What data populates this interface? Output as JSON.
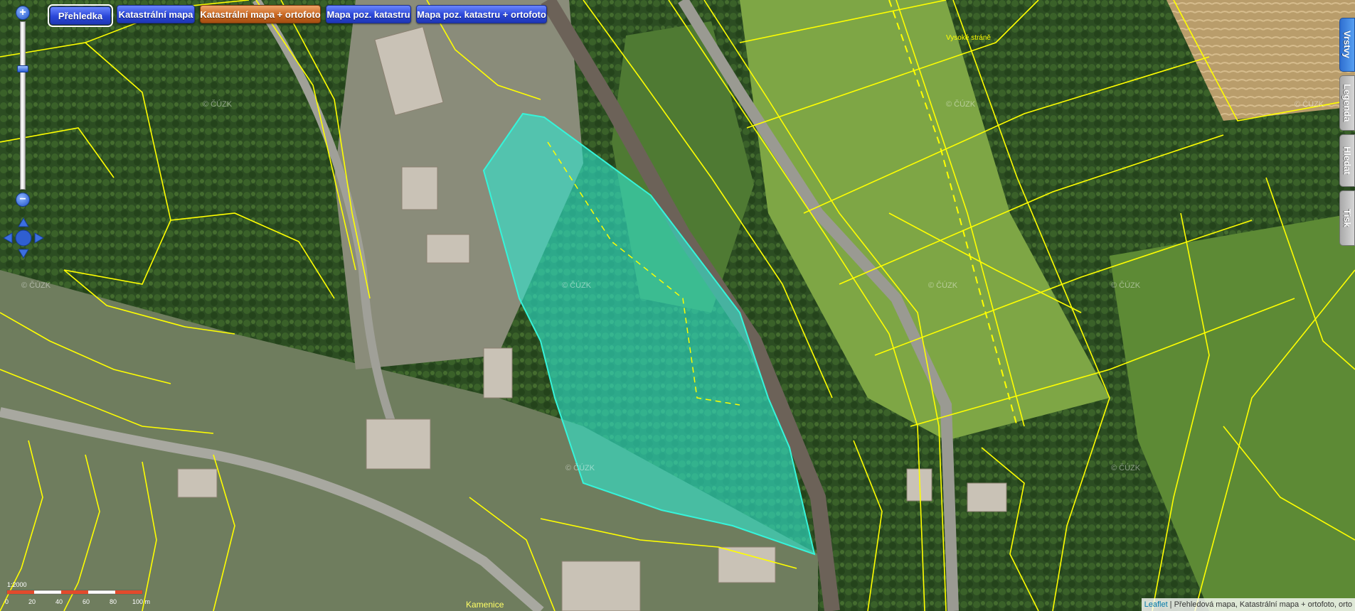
{
  "toolbar": {
    "buttons": [
      {
        "label": "Přehledka",
        "style": "blue",
        "active": true
      },
      {
        "label": "Katastrální mapa",
        "style": "blue",
        "active": false
      },
      {
        "label": "Katastrální mapa + ortofoto",
        "style": "orange",
        "active": false
      },
      {
        "label": "Mapa poz. katastru",
        "style": "blue",
        "active": false
      },
      {
        "label": "Mapa poz. katastru + ortofoto",
        "style": "blue",
        "active": false
      }
    ]
  },
  "side_tabs": [
    "Vrstvy",
    "Legenda",
    "Hledat",
    "Tisk"
  ],
  "zoom": {
    "in_symbol": "+",
    "out_symbol": "−",
    "level_fraction": 0.72
  },
  "map": {
    "watermark": "© ČÚZK",
    "place_label": "Vysoké stráně",
    "town_label": "Kamenice",
    "colors": {
      "parcel_line": "#ffff00",
      "highlight": "#2ee8d0",
      "forest": "#284a1f",
      "meadow": "#6f9a3d",
      "field": "#b79b6a"
    }
  },
  "scale": {
    "ratio": "1:2000",
    "ticks": [
      "0",
      "20",
      "40",
      "60",
      "80",
      "100 m"
    ]
  },
  "attribution": {
    "link": "Leaflet",
    "text": " | Přehledová mapa, Katastrální mapa + ortofoto, orto"
  }
}
